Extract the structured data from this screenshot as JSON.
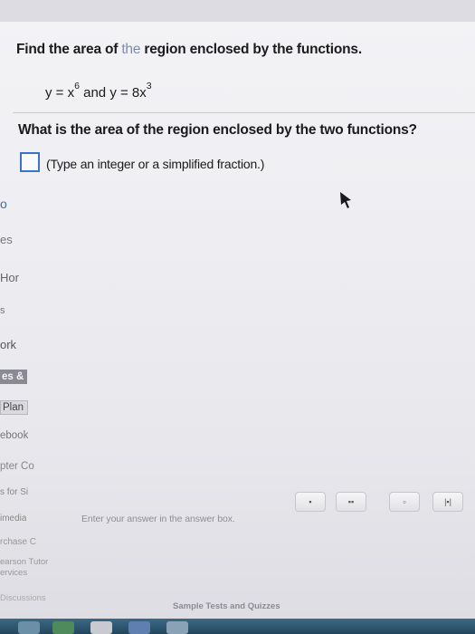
{
  "question": {
    "title_start": "Find the area of ",
    "title_highlight": "the",
    "title_end": " region enclosed by the functions.",
    "eq1_lhs": "y = x",
    "eq1_exp": "6",
    "eq_join": " and y = 8x",
    "eq2_exp": "3",
    "prompt": "What is the area of the region enclosed by the two functions?",
    "answer_value": "",
    "hint": "(Type an integer or a simplified fraction.)"
  },
  "sidebar": {
    "items": [
      {
        "label": "o"
      },
      {
        "label": "es"
      },
      {
        "label": "Hor"
      },
      {
        "label": "s"
      },
      {
        "label": "ork"
      },
      {
        "label": "es &"
      },
      {
        "label": "Plan"
      },
      {
        "label": "ebook"
      },
      {
        "label": "pter Co"
      },
      {
        "label": "s for Si"
      },
      {
        "label": "imedia"
      },
      {
        "label": "rchase C"
      },
      {
        "label": "earson Tutor"
      },
      {
        "label": "ervices"
      },
      {
        "label": "Discussions"
      }
    ]
  },
  "toolbar": {
    "buttons": [
      {
        "label": "▪"
      },
      {
        "label": "▪▪"
      },
      {
        "label": "▫"
      },
      {
        "label": "|▪|"
      }
    ]
  },
  "status": {
    "message": "Enter your answer in the answer box."
  },
  "footer": {
    "link": "Sample Tests and Quizzes"
  },
  "colors": {
    "accent": "#3a74c8",
    "highlight": "#7d8ca8"
  }
}
